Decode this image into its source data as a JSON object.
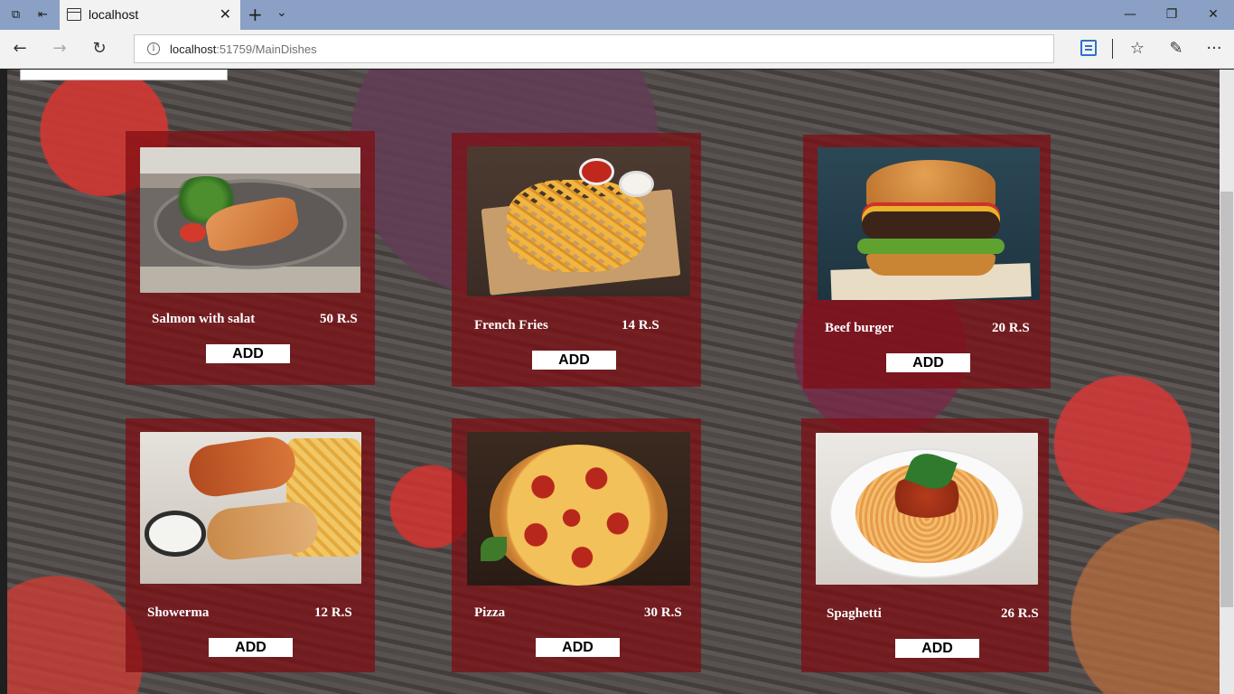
{
  "browser": {
    "tab_title": "localhost",
    "url_host": "localhost",
    "url_rest": ":51759/MainDishes",
    "tab_close_glyph": "✕",
    "new_tab_glyph": "+",
    "tab_menu_glyph": "⌄",
    "back_glyph": "←",
    "forward_glyph": "→",
    "refresh_glyph": "↻",
    "favorites_glyph": "☆",
    "notes_glyph": "✎",
    "more_glyph": "···",
    "minimize_glyph": "—",
    "restore_glyph": "❐",
    "close_glyph": "✕"
  },
  "menu": {
    "add_label": "ADD",
    "dishes": [
      {
        "name": "Salmon with salat",
        "price": "50 R.S",
        "image": "salmon"
      },
      {
        "name": "French Fries",
        "price": "14 R.S",
        "image": "fries"
      },
      {
        "name": "Beef burger",
        "price": "20 R.S",
        "image": "burger"
      },
      {
        "name": "Showerma",
        "price": "12 R.S",
        "image": "shawarma"
      },
      {
        "name": "Pizza",
        "price": "30 R.S",
        "image": "pizza"
      },
      {
        "name": "Spaghetti",
        "price": "26 R.S",
        "image": "spaghetti"
      }
    ]
  }
}
